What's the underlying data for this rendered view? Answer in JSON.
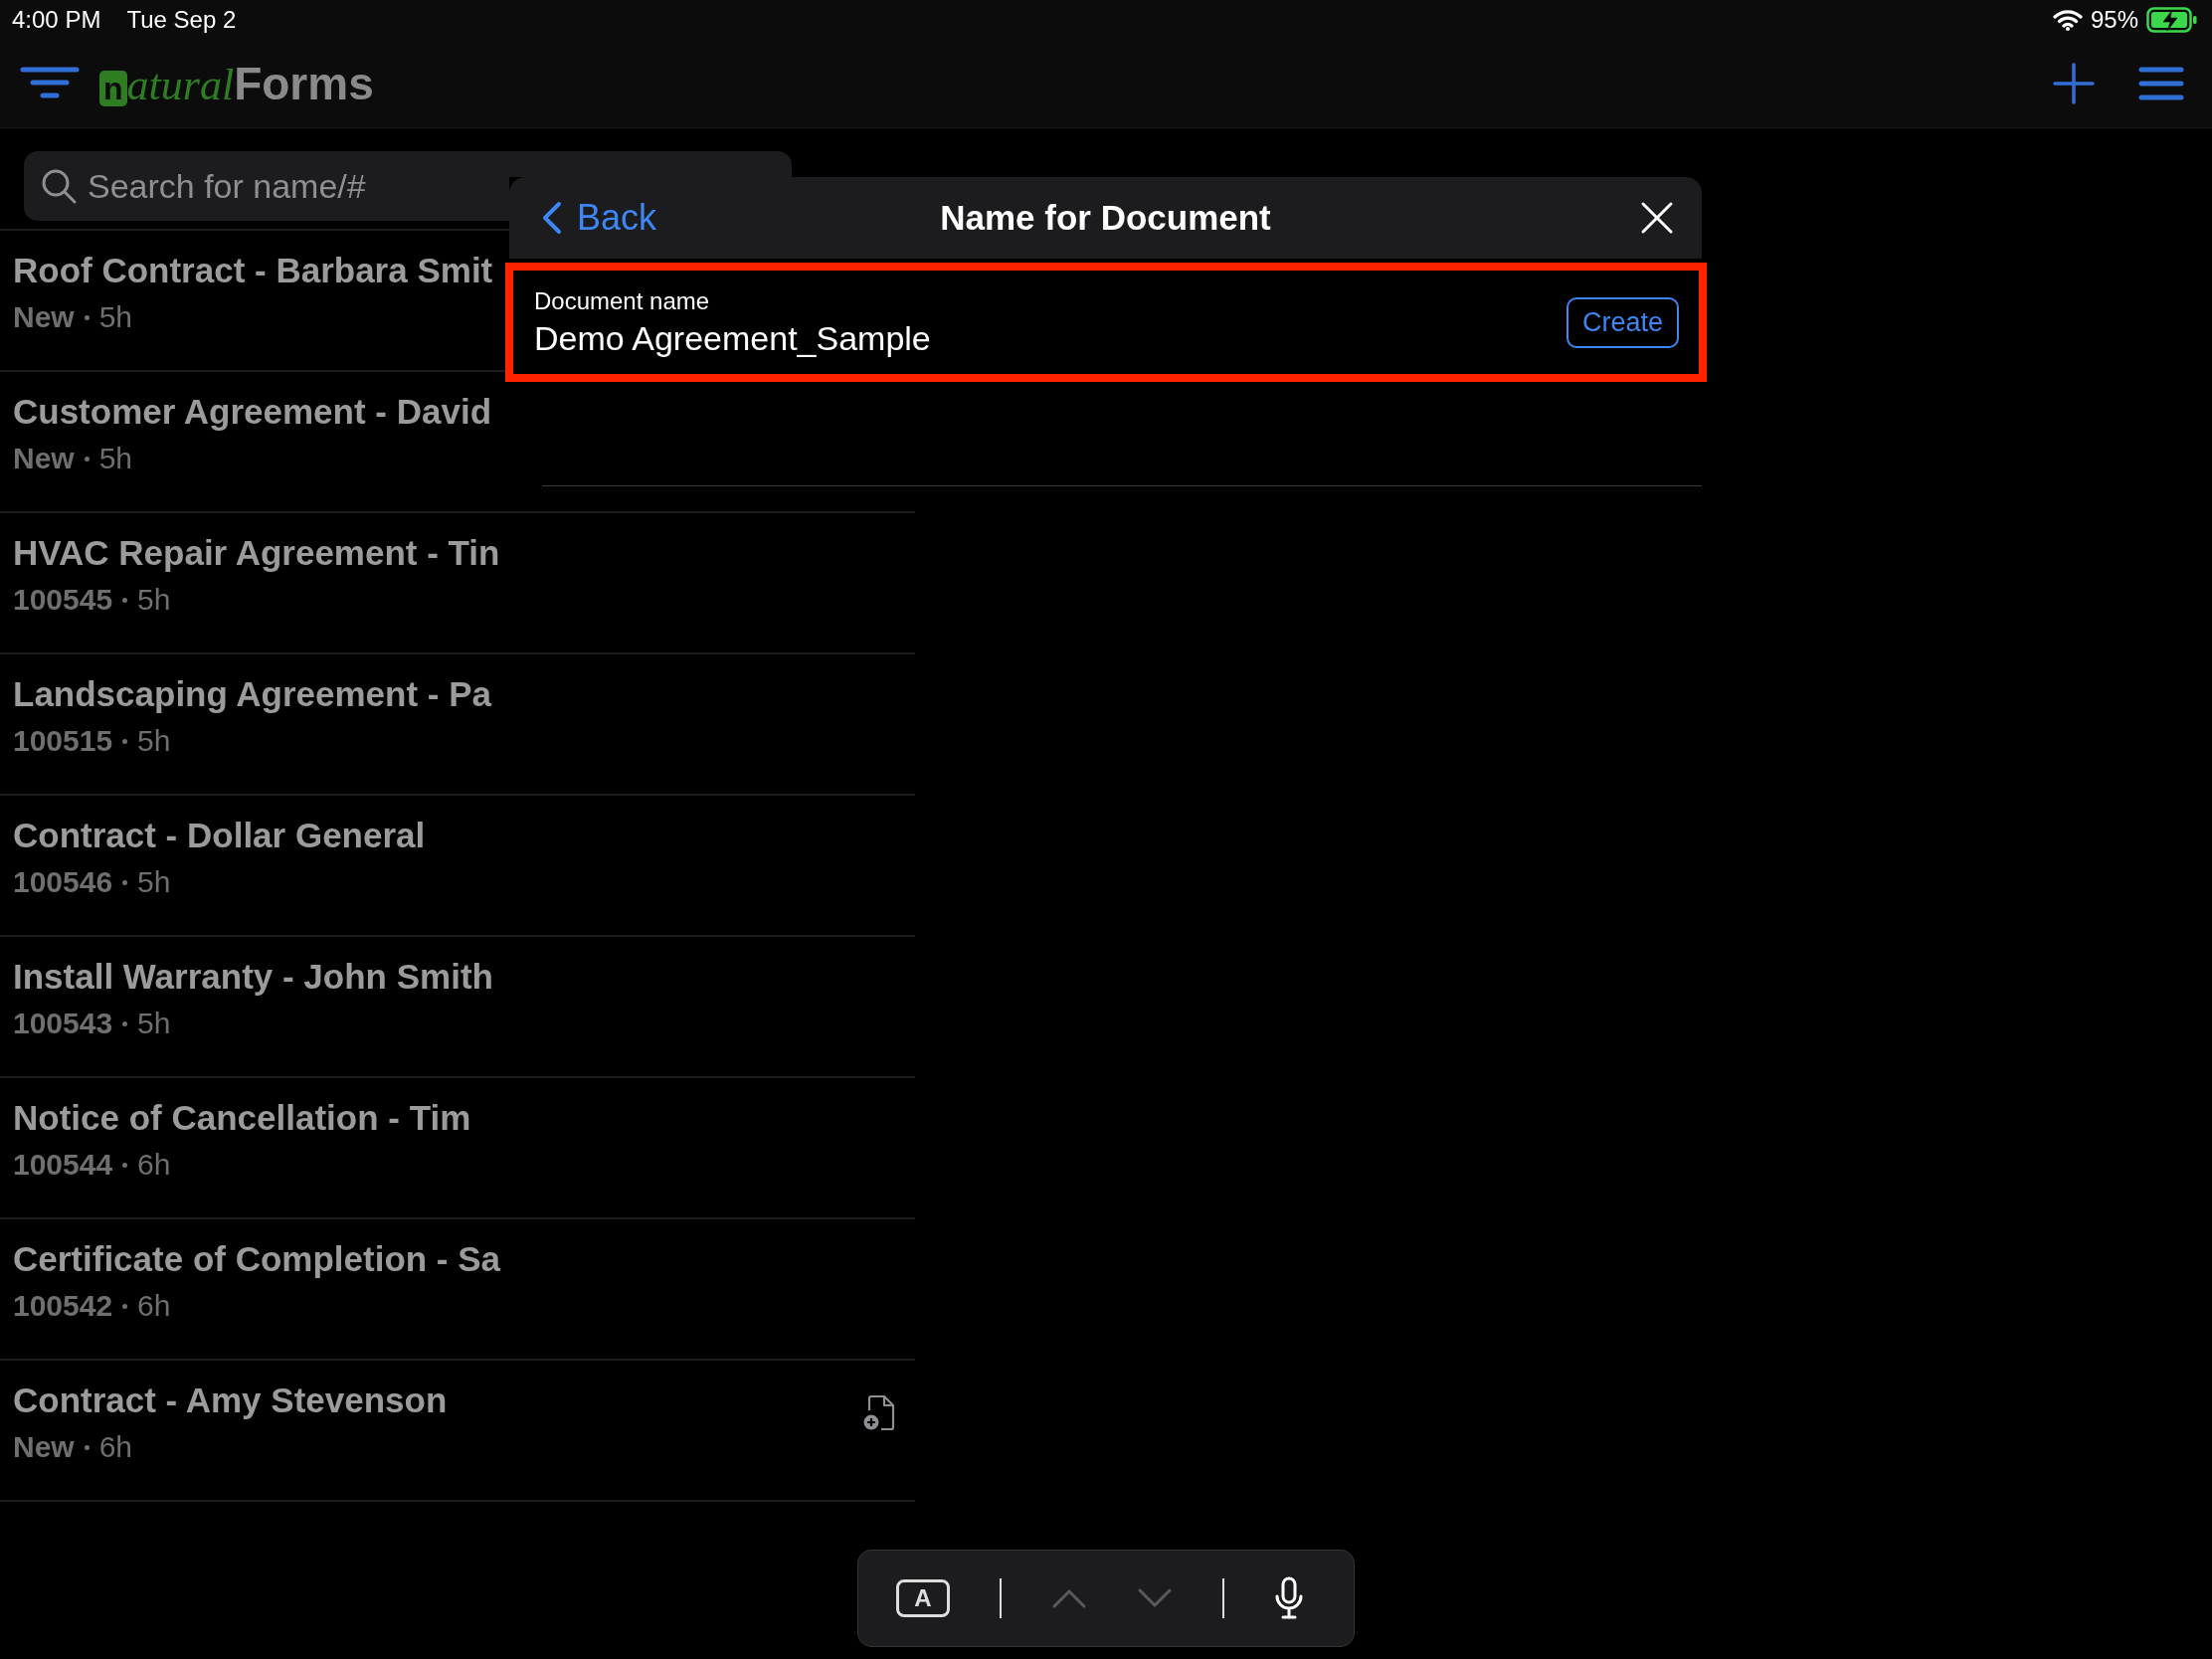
{
  "status_bar": {
    "time": "4:00 PM",
    "date": "Tue Sep 2",
    "battery": "95%"
  },
  "header": {
    "logo": {
      "boxed": "n",
      "script": "atural",
      "bold": "Forms"
    }
  },
  "search": {
    "placeholder": "Search for name/#"
  },
  "documents": [
    {
      "title": "Roof Contract - Barbara Smit",
      "status": "New",
      "time": "5h"
    },
    {
      "title": "Customer Agreement - David",
      "status": "New",
      "time": "5h"
    },
    {
      "title": "HVAC Repair Agreement - Tin",
      "status": "100545",
      "time": "5h"
    },
    {
      "title": "Landscaping Agreement - Pa",
      "status": "100515",
      "time": "5h"
    },
    {
      "title": "Contract - Dollar General",
      "status": "100546",
      "time": "5h"
    },
    {
      "title": "Install Warranty - John Smith",
      "status": "100543",
      "time": "5h"
    },
    {
      "title": "Notice of Cancellation - Tim",
      "status": "100544",
      "time": "6h"
    },
    {
      "title": "Certificate of Completion - Sa",
      "status": "100542",
      "time": "6h"
    },
    {
      "title": "Contract - Amy Stevenson",
      "status": "New",
      "time": "6h",
      "doc_icon": true
    }
  ],
  "dialog": {
    "back": "Back",
    "title": "Name for Document",
    "field": {
      "label": "Document name",
      "value": "Demo Agreement_Sample"
    },
    "create": "Create"
  },
  "keyboard_bar": {
    "key": "A",
    "up_disabled": true,
    "down_disabled": true
  }
}
